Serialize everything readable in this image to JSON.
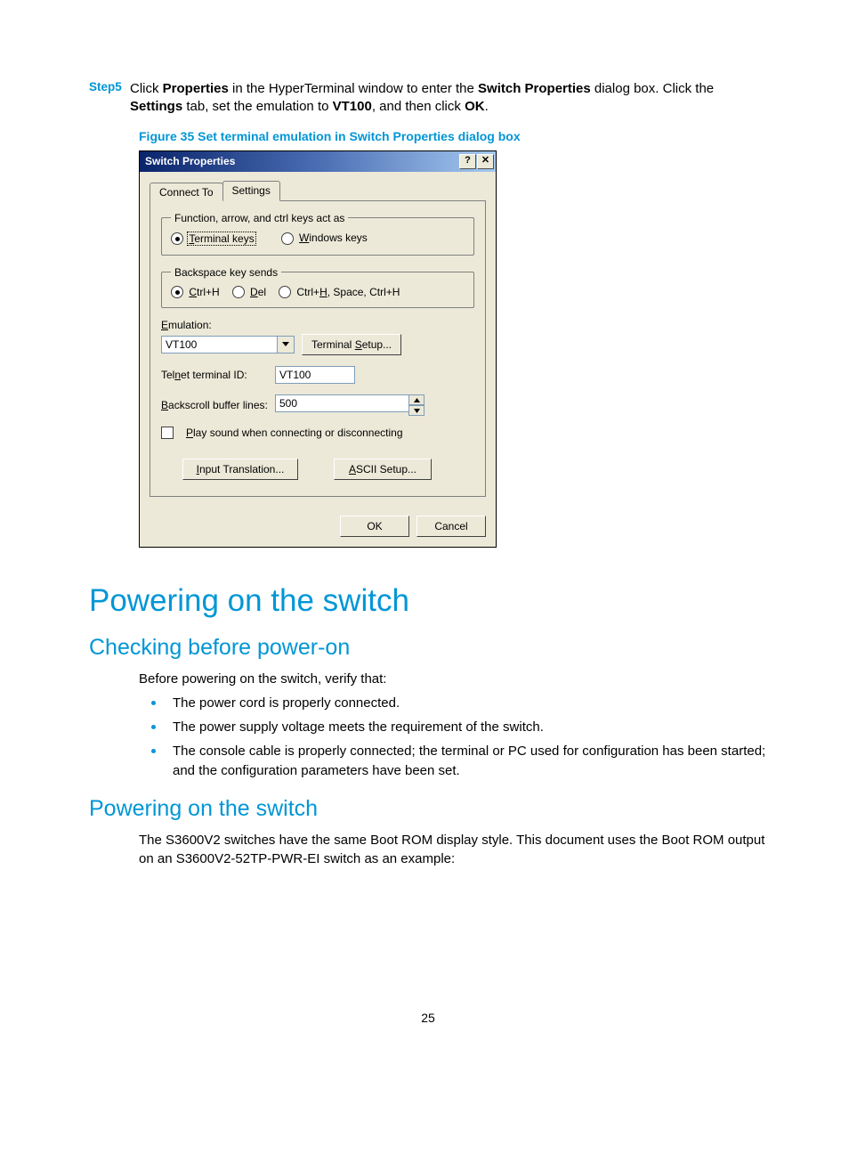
{
  "step": {
    "label": "Step5",
    "text_pre": "Click ",
    "bold1": "Properties",
    "text_mid1": " in the HyperTerminal window to enter the ",
    "bold2": "Switch Properties",
    "text_mid2": " dialog box. Click the ",
    "bold3": "Settings",
    "text_mid3": " tab, set the emulation to ",
    "bold4": "VT100",
    "text_mid4": ", and then click ",
    "bold5": "OK",
    "text_end": "."
  },
  "figure_caption": "Figure 35 Set terminal emulation in Switch Properties dialog box",
  "dialog": {
    "title": "Switch Properties",
    "help_btn": "?",
    "close_btn": "✕",
    "tabs": {
      "connect": "Connect To",
      "settings": "Settings"
    },
    "group1": {
      "legend": "Function, arrow, and ctrl keys act as",
      "opt1_u": "T",
      "opt1": "erminal keys",
      "opt2_u": "W",
      "opt2": "indows keys"
    },
    "group2": {
      "legend": "Backspace key sends",
      "opt1_u": "C",
      "opt1": "trl+H",
      "opt2_u": "D",
      "opt2": "el",
      "opt3a": "Ctrl+",
      "opt3_u": "H",
      "opt3b": ", Space, Ctrl+H"
    },
    "emulation_label_u": "E",
    "emulation_label": "mulation:",
    "emulation_value": "VT100",
    "terminal_setup_pre": "Terminal ",
    "terminal_setup_u": "S",
    "terminal_setup_post": "etup...",
    "telnet_label_pre": "Tel",
    "telnet_label_u": "n",
    "telnet_label_post": "et terminal ID:",
    "telnet_value": "VT100",
    "backscroll_label_u": "B",
    "backscroll_label": "ackscroll buffer lines:",
    "backscroll_value": "500",
    "playsound_u": "P",
    "playsound": "lay sound when connecting or disconnecting",
    "input_trans_u": "I",
    "input_trans": "nput Translation...",
    "ascii_u": "A",
    "ascii": "SCII Setup...",
    "ok": "OK",
    "cancel": "Cancel"
  },
  "h1": "Powering on the switch",
  "h2a": "Checking before power-on",
  "check_intro": "Before powering on the switch, verify that:",
  "bullets": [
    "The power cord is properly connected.",
    "The power supply voltage meets the requirement of the switch.",
    "The console cable is properly connected; the terminal or PC used for configuration has been started; and the configuration parameters have been set."
  ],
  "h2b": "Powering on the switch",
  "power_text": "The S3600V2 switches have the same Boot ROM display style. This document uses the Boot ROM output on an S3600V2-52TP-PWR-EI switch as an example:",
  "pagenum": "25"
}
